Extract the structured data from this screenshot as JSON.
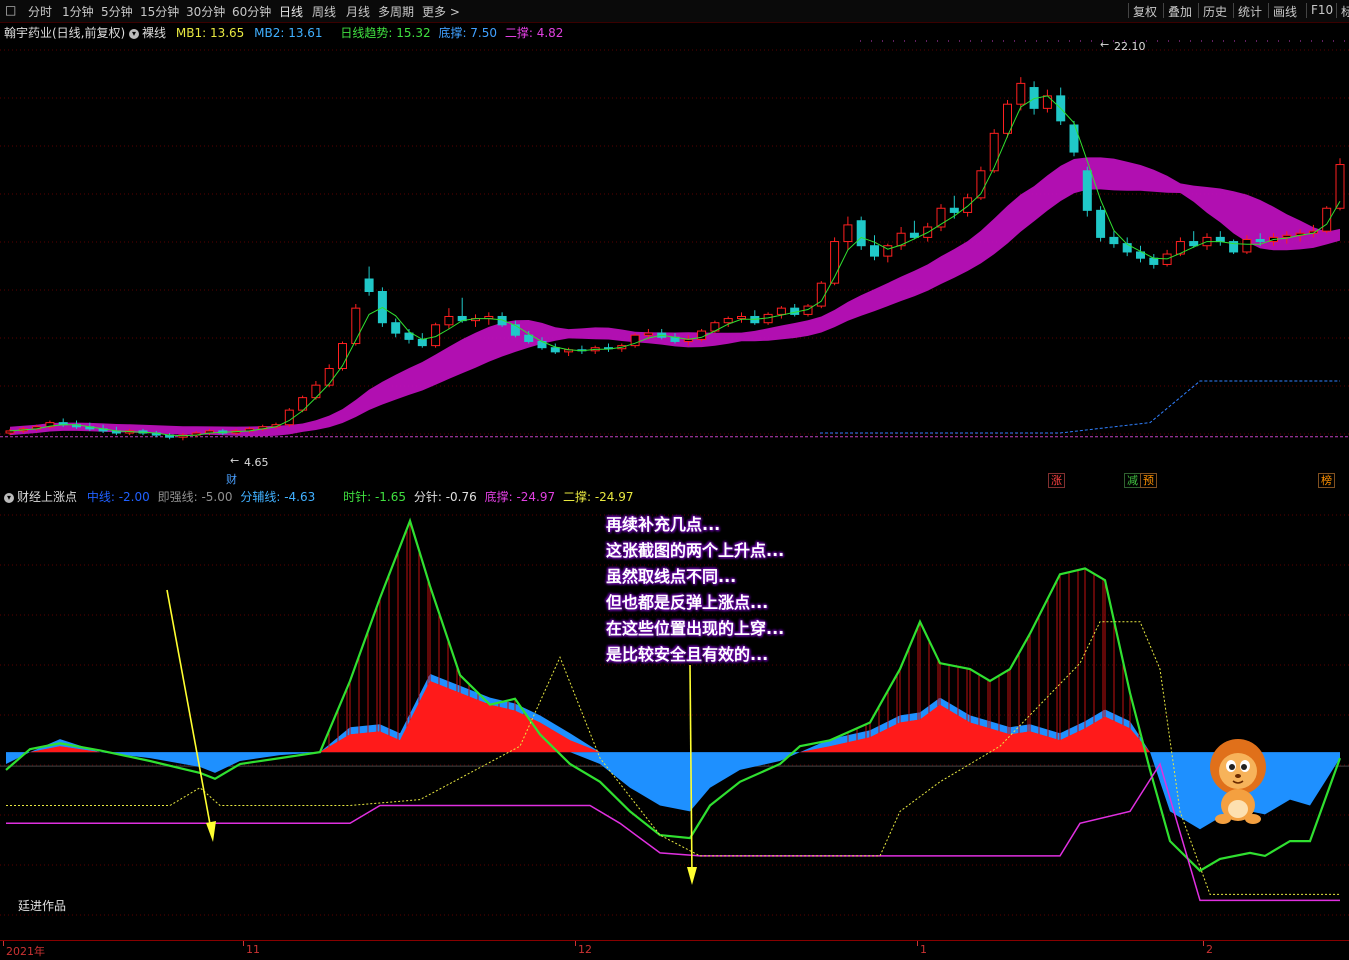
{
  "toolbar": {
    "periods": [
      "分时",
      "1分钟",
      "5分钟",
      "15分钟",
      "30分钟",
      "60分钟",
      "日线",
      "周线",
      "月线",
      "多周期",
      "更多 >"
    ],
    "active_period": "日线",
    "right_buttons": [
      "复权",
      "叠加",
      "历史",
      "统计",
      "画线",
      "F10",
      "标"
    ]
  },
  "upper_info": {
    "stock": "翰宇药业(日线,前复权)",
    "mode": "裸线",
    "mb1": "MB1: 13.65",
    "mb2": "MB2: 13.61",
    "trend": "日线趋势: 15.32",
    "base": "底撑: 7.50",
    "second": "二撑: 4.82"
  },
  "upper_labels": {
    "high": "22.10",
    "low": "4.65"
  },
  "badges": [
    {
      "text": "财",
      "color": "#4aa0ff"
    },
    {
      "text": "涨",
      "color": "#ff4040"
    },
    {
      "text": "减",
      "color": "#40c040"
    },
    {
      "text": "预",
      "color": "#ff9000"
    },
    {
      "text": "榜",
      "color": "#ff9000"
    }
  ],
  "lower_info": {
    "name": "财经上涨点",
    "mid": "中线: -2.00",
    "strong": "即强线: -5.00",
    "aux": "分辅线: -4.63",
    "hour": "时针: -1.65",
    "minute": "分针: -0.76",
    "base": "底撑: -24.97",
    "second": "二撑: -24.97"
  },
  "note_lines": [
    "再续补充几点...",
    "这张截图的两个上升点...",
    "虽然取线点不同...",
    "但也都是反弹上涨点...",
    "在这些位置出现的上穿...",
    "是比较安全且有效的..."
  ],
  "author": "廷进作品",
  "x_axis": [
    "2021年",
    "11",
    "12",
    "1",
    "2"
  ],
  "colors": {
    "up": "#ff2020",
    "down": "#20c8c8",
    "magenta": "#c010c0",
    "green": "#30e030",
    "blue": "#1e90ff"
  },
  "chart_data": {
    "type": "candlestick",
    "title": "翰宇药业(日线,前复权)",
    "candles": [
      [
        5.0,
        5.2,
        4.9,
        5.1
      ],
      [
        5.1,
        5.3,
        5.0,
        5.2
      ],
      [
        5.2,
        5.4,
        5.1,
        5.3
      ],
      [
        5.3,
        5.6,
        5.2,
        5.5
      ],
      [
        5.5,
        5.7,
        5.3,
        5.4
      ],
      [
        5.4,
        5.6,
        5.2,
        5.3
      ],
      [
        5.3,
        5.5,
        5.1,
        5.2
      ],
      [
        5.2,
        5.4,
        5.0,
        5.1
      ],
      [
        5.1,
        5.3,
        4.9,
        5.0
      ],
      [
        5.0,
        5.2,
        4.9,
        5.1
      ],
      [
        5.1,
        5.2,
        4.9,
        5.0
      ],
      [
        5.0,
        5.1,
        4.8,
        4.9
      ],
      [
        4.9,
        5.0,
        4.7,
        4.8
      ],
      [
        4.8,
        5.0,
        4.65,
        4.9
      ],
      [
        4.9,
        5.1,
        4.8,
        5.0
      ],
      [
        5.0,
        5.2,
        4.9,
        5.1
      ],
      [
        5.1,
        5.2,
        4.9,
        5.0
      ],
      [
        5.0,
        5.2,
        4.9,
        5.1
      ],
      [
        5.1,
        5.3,
        5.0,
        5.2
      ],
      [
        5.2,
        5.4,
        5.1,
        5.3
      ],
      [
        5.3,
        5.5,
        5.2,
        5.4
      ],
      [
        5.4,
        6.2,
        5.3,
        6.1
      ],
      [
        6.1,
        6.8,
        6.0,
        6.7
      ],
      [
        6.7,
        7.5,
        6.6,
        7.3
      ],
      [
        7.3,
        8.3,
        7.2,
        8.1
      ],
      [
        8.1,
        9.4,
        8.0,
        9.3
      ],
      [
        9.3,
        11.2,
        9.2,
        11.0
      ],
      [
        12.4,
        13.0,
        11.6,
        11.8
      ],
      [
        11.8,
        12.0,
        10.1,
        10.3
      ],
      [
        10.3,
        10.5,
        9.6,
        9.8
      ],
      [
        9.8,
        10.0,
        9.3,
        9.5
      ],
      [
        9.5,
        9.8,
        9.1,
        9.2
      ],
      [
        9.2,
        10.3,
        9.1,
        10.2
      ],
      [
        10.2,
        11.0,
        10.0,
        10.6
      ],
      [
        10.6,
        11.5,
        10.3,
        10.4
      ],
      [
        10.4,
        10.7,
        10.1,
        10.5
      ],
      [
        10.5,
        10.8,
        10.2,
        10.6
      ],
      [
        10.6,
        10.8,
        10.1,
        10.2
      ],
      [
        10.2,
        10.4,
        9.6,
        9.7
      ],
      [
        9.7,
        9.9,
        9.3,
        9.4
      ],
      [
        9.4,
        9.6,
        9.0,
        9.1
      ],
      [
        9.1,
        9.3,
        8.8,
        8.9
      ],
      [
        8.9,
        9.1,
        8.7,
        9.0
      ],
      [
        9.0,
        9.2,
        8.8,
        8.95
      ],
      [
        8.95,
        9.2,
        8.8,
        9.1
      ],
      [
        9.1,
        9.3,
        8.9,
        9.05
      ],
      [
        9.05,
        9.3,
        8.9,
        9.2
      ],
      [
        9.2,
        9.8,
        9.1,
        9.7
      ],
      [
        9.7,
        10.0,
        9.5,
        9.8
      ],
      [
        9.8,
        10.0,
        9.5,
        9.6
      ],
      [
        9.6,
        9.8,
        9.3,
        9.4
      ],
      [
        9.4,
        9.7,
        9.2,
        9.5
      ],
      [
        9.5,
        10.0,
        9.4,
        9.9
      ],
      [
        9.9,
        10.4,
        9.8,
        10.3
      ],
      [
        10.3,
        10.6,
        10.1,
        10.5
      ],
      [
        10.5,
        10.8,
        10.3,
        10.6
      ],
      [
        10.6,
        10.9,
        10.2,
        10.3
      ],
      [
        10.3,
        10.8,
        10.2,
        10.7
      ],
      [
        10.7,
        11.1,
        10.5,
        11.0
      ],
      [
        11.0,
        11.2,
        10.6,
        10.7
      ],
      [
        10.7,
        11.2,
        10.6,
        11.1
      ],
      [
        11.1,
        12.3,
        11.0,
        12.2
      ],
      [
        12.2,
        14.4,
        12.1,
        14.2
      ],
      [
        14.2,
        15.4,
        13.8,
        15.0
      ],
      [
        15.2,
        15.4,
        13.8,
        14.0
      ],
      [
        14.0,
        14.5,
        13.3,
        13.5
      ],
      [
        13.5,
        14.1,
        13.2,
        14.0
      ],
      [
        14.0,
        14.9,
        13.8,
        14.6
      ],
      [
        14.6,
        15.2,
        14.3,
        14.4
      ],
      [
        14.4,
        15.1,
        14.2,
        14.9
      ],
      [
        14.9,
        16.0,
        14.7,
        15.8
      ],
      [
        15.8,
        16.4,
        15.3,
        15.6
      ],
      [
        15.6,
        16.5,
        15.4,
        16.3
      ],
      [
        16.3,
        17.8,
        16.2,
        17.6
      ],
      [
        17.6,
        19.6,
        17.5,
        19.4
      ],
      [
        19.4,
        21.0,
        19.2,
        20.8
      ],
      [
        20.8,
        22.1,
        20.5,
        21.8
      ],
      [
        21.6,
        21.9,
        20.3,
        20.6
      ],
      [
        20.6,
        21.5,
        20.4,
        21.2
      ],
      [
        21.2,
        21.6,
        19.8,
        20.0
      ],
      [
        19.8,
        20.0,
        18.3,
        18.5
      ],
      [
        17.6,
        17.8,
        15.4,
        15.7
      ],
      [
        15.7,
        15.9,
        14.2,
        14.4
      ],
      [
        14.4,
        14.7,
        13.9,
        14.1
      ],
      [
        14.1,
        14.4,
        13.5,
        13.7
      ],
      [
        13.7,
        14.0,
        13.2,
        13.4
      ],
      [
        13.4,
        13.6,
        12.9,
        13.1
      ],
      [
        13.1,
        13.8,
        13.0,
        13.6
      ],
      [
        13.6,
        14.4,
        13.5,
        14.2
      ],
      [
        14.2,
        14.7,
        13.9,
        14.0
      ],
      [
        14.0,
        14.6,
        13.8,
        14.4
      ],
      [
        14.4,
        14.7,
        14.0,
        14.2
      ],
      [
        14.2,
        14.3,
        13.6,
        13.7
      ],
      [
        13.7,
        14.5,
        13.6,
        14.3
      ],
      [
        14.3,
        14.6,
        14.0,
        14.2
      ],
      [
        14.2,
        14.6,
        14.0,
        14.4
      ],
      [
        14.4,
        14.7,
        14.1,
        14.5
      ],
      [
        14.5,
        14.8,
        14.2,
        14.6
      ],
      [
        14.6,
        15.0,
        14.4,
        14.7
      ],
      [
        14.7,
        15.9,
        14.6,
        15.8
      ],
      [
        15.8,
        18.2,
        15.7,
        17.9
      ]
    ],
    "y_range": [
      3.8,
      23.5
    ],
    "lower_range": [
      -30,
      40
    ]
  }
}
